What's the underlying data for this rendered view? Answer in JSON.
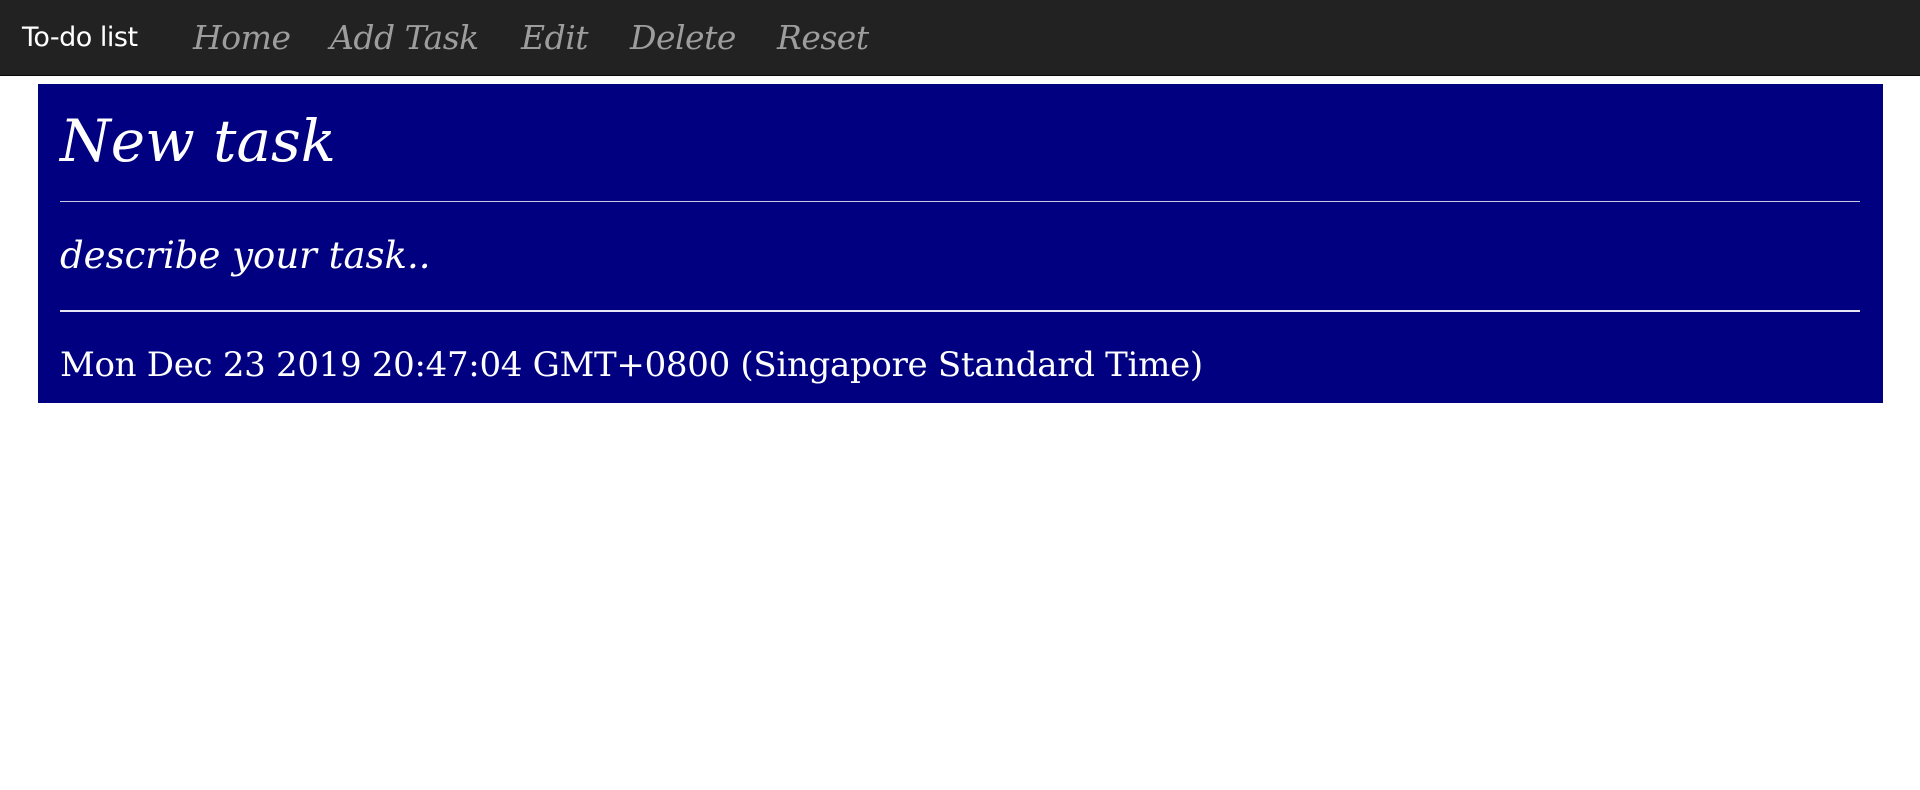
{
  "navbar": {
    "brand": "To-do list",
    "links": [
      {
        "label": "Home"
      },
      {
        "label": "Add Task"
      },
      {
        "label": "Edit"
      },
      {
        "label": "Delete"
      },
      {
        "label": "Reset"
      }
    ]
  },
  "task": {
    "title": "New task",
    "description": "describe your task..",
    "date": "Mon Dec 23 2019 20:47:04 GMT+0800 (Singapore Standard Time)"
  },
  "colors": {
    "navbar_bg": "#222222",
    "card_bg": "#000080",
    "nav_link": "#9d9d9d",
    "text": "#ffffff"
  }
}
